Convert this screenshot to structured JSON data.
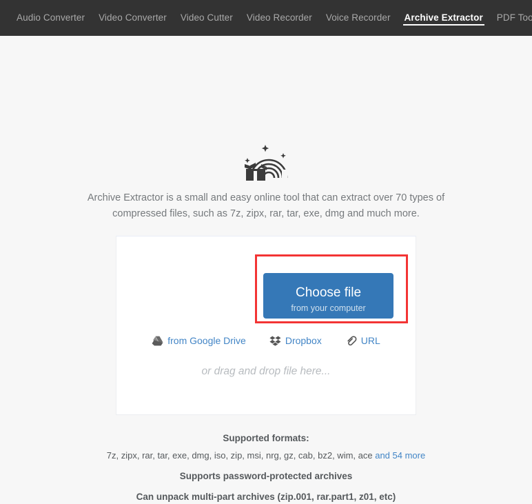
{
  "nav": {
    "items": [
      {
        "label": "Audio Converter",
        "active": false
      },
      {
        "label": "Video Converter",
        "active": false
      },
      {
        "label": "Video Cutter",
        "active": false
      },
      {
        "label": "Video Recorder",
        "active": false
      },
      {
        "label": "Voice Recorder",
        "active": false
      },
      {
        "label": "Archive Extractor",
        "active": true
      },
      {
        "label": "PDF Tools",
        "active": false
      }
    ]
  },
  "hero": {
    "logo_icon": "box-rainbow-icon",
    "intro_line1": "Archive Extractor is a small and easy online tool that can extract over 70 types of",
    "intro_line2": "compressed files, such as 7z, zipx, rar, tar, exe, dmg and much more."
  },
  "upload": {
    "choose_file_main": "Choose file",
    "choose_file_sub": "from your computer",
    "sources": [
      {
        "label": "from Google Drive",
        "icon": "google-drive-icon"
      },
      {
        "label": "Dropbox",
        "icon": "dropbox-icon"
      },
      {
        "label": "URL",
        "icon": "paperclip-icon"
      }
    ],
    "dragdrop": "or drag and drop file here...",
    "highlight_color": "#f33434",
    "button_color": "#3578b7"
  },
  "footer": {
    "formats_heading": "Supported formats:",
    "formats_list": "7z, zipx, rar, tar, exe, dmg, iso, zip, msi, nrg, gz, cab, bz2, wim, ace ",
    "formats_more_link": "and 54 more",
    "password_line": "Supports password-protected archives",
    "multipart_line": "Can unpack multi-part archives (zip.001, rar.part1, z01, etc)",
    "link_color": "#4285c6"
  }
}
